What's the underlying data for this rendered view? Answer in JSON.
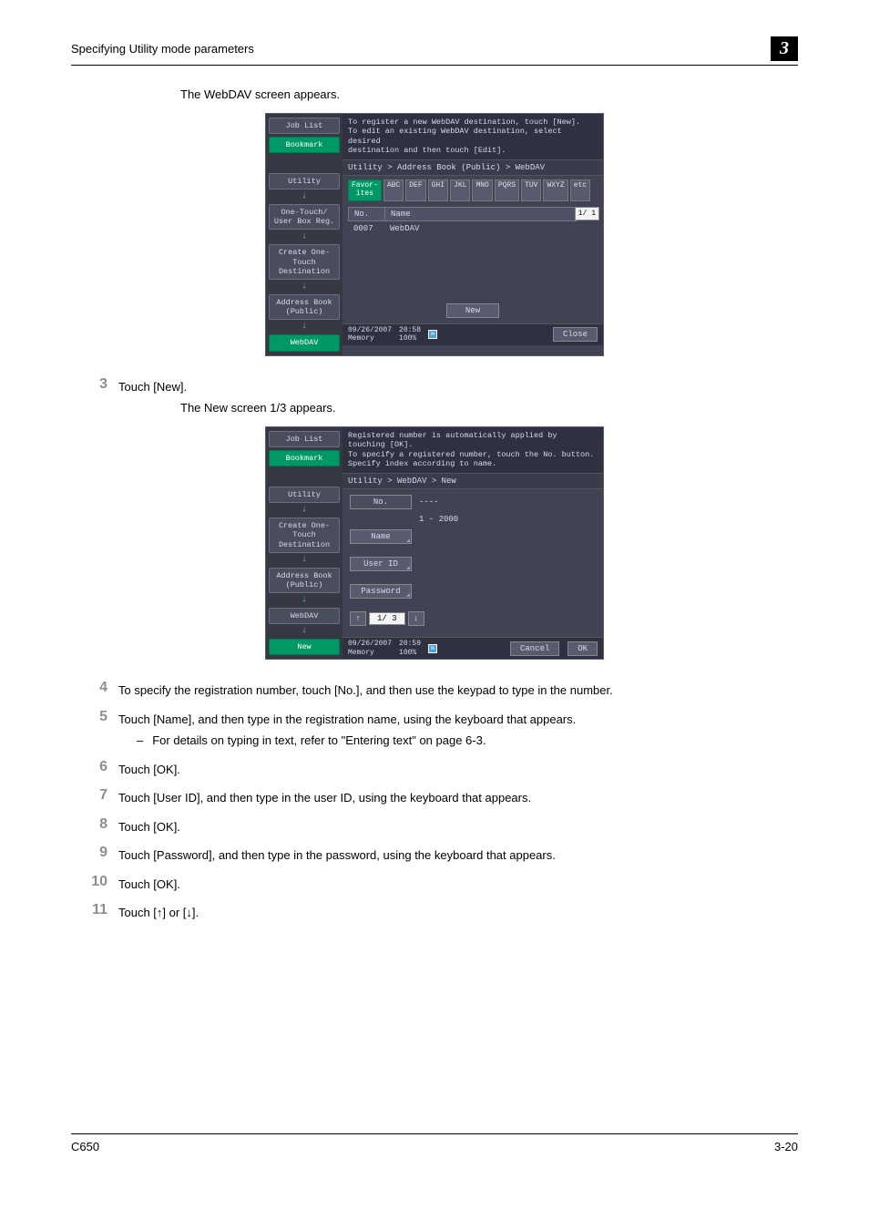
{
  "header": {
    "section_title": "Specifying Utility mode parameters",
    "chapter_number": "3"
  },
  "intro_line": "The WebDAV screen appears.",
  "panel1": {
    "sidebar": {
      "job_list": "Job List",
      "bookmark": "Bookmark",
      "utility": "Utility",
      "one_touch": "One-Touch/\nUser Box Reg.",
      "create_one_touch": "Create One-Touch\nDestination",
      "address_book": "Address Book\n(Public)",
      "webdav": "WebDAV"
    },
    "instruction": "To register a new WebDAV destination, touch [New].\nTo edit an existing WebDAV destination, select desired\ndestination and then touch [Edit].",
    "breadcrumb": "Utility > Address Book (Public) > WebDAV",
    "tabs": [
      "Favor-\nites",
      "ABC",
      "DEF",
      "GHI",
      "JKL",
      "MNO",
      "PQRS",
      "TUV",
      "WXYZ",
      "etc"
    ],
    "list": {
      "head_no": "No.",
      "head_name": "Name",
      "row_no": "0007",
      "row_name": "WebDAV",
      "page_indicator": "1/  1"
    },
    "new_button": "New",
    "status": {
      "date": "09/26/2007",
      "time": "20:58",
      "memory_label": "Memory",
      "memory_value": "100%",
      "close": "Close"
    }
  },
  "step3": {
    "num": "3",
    "text": "Touch [New].",
    "subtext": "The New screen 1/3 appears."
  },
  "panel2": {
    "sidebar": {
      "job_list": "Job List",
      "bookmark": "Bookmark",
      "utility": "Utility",
      "create_one_touch": "Create One-Touch\nDestination",
      "address_book": "Address Book\n(Public)",
      "webdav": "WebDAV",
      "new": "New"
    },
    "instruction": "Registered number is automatically applied by touching [OK].\nTo specify a registered number, touch the No. button.\nSpecify index according to name.",
    "breadcrumb": "Utility > WebDAV > New",
    "form": {
      "no_label": "No.",
      "no_value": "----",
      "no_range": "1 - 2000",
      "name_label": "Name",
      "user_id_label": "User ID",
      "password_label": "Password"
    },
    "pager": {
      "up": "↑",
      "num": "1/ 3",
      "down": "↓"
    },
    "status": {
      "date": "09/26/2007",
      "time": "20:59",
      "memory_label": "Memory",
      "memory_value": "100%",
      "cancel": "Cancel",
      "ok": "OK"
    }
  },
  "steps": {
    "s4": {
      "num": "4",
      "text": "To specify the registration number, touch [No.], and then use the keypad to type in the number."
    },
    "s5": {
      "num": "5",
      "text": "Touch [Name], and then type in the registration name, using the keyboard that appears.",
      "sub": "For details on typing in text, refer to \"Entering text\" on page 6-3."
    },
    "s6": {
      "num": "6",
      "text": "Touch [OK]."
    },
    "s7": {
      "num": "7",
      "text": "Touch [User ID], and then type in the user ID, using the keyboard that appears."
    },
    "s8": {
      "num": "8",
      "text": "Touch [OK]."
    },
    "s9": {
      "num": "9",
      "text": "Touch [Password], and then type in the password, using the keyboard that appears."
    },
    "s10": {
      "num": "10",
      "text": "Touch [OK]."
    },
    "s11": {
      "num": "11",
      "text": "Touch [↑] or [↓]."
    }
  },
  "footer": {
    "left": "C650",
    "right": "3-20"
  }
}
